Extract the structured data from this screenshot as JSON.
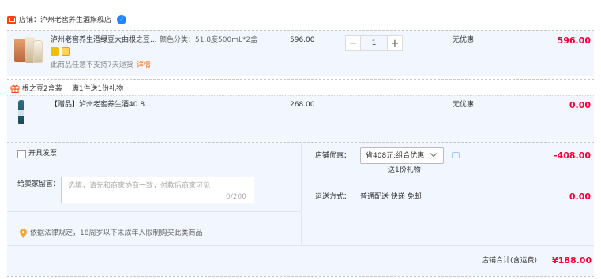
{
  "shop": {
    "label": "店铺：泸州老窖养生酒旗舰店",
    "badge_icon": "verified-icon",
    "badge_glyph": "✓"
  },
  "items": [
    {
      "title": "泸州老窖养生酒绿豆大曲根之豆...",
      "spec": "颜色分类：51.8度500mL*2盒",
      "note": "此商品任意不支持7天退货",
      "note_link": "详情",
      "unit_price": "596.00",
      "quantity": "1",
      "promo": "无优惠",
      "subtotal": "596.00"
    },
    {
      "title": "【赠品】泸州老窖养生酒40.8...",
      "unit_price": "268.00",
      "promo": "无优惠",
      "subtotal": "0.00"
    }
  ],
  "gift_bar": {
    "name": "根之豆2盒装",
    "desc": "满1件送1份礼物"
  },
  "order": {
    "invoice_label": "开具发票",
    "message_label": "给卖家留言：",
    "message_placeholder": "选填，请先和商家协商一致，付款后商家可见",
    "message_count": "0/200",
    "law_note": "依据法律规定，18周岁以下未成年人限制购买此类商品",
    "discount_label": "店铺优惠：",
    "discount_select": "省408元:组合优惠",
    "discount_sub": "送1份礼物",
    "discount_amount": "-408.00",
    "shipping_label": "运送方式：",
    "shipping_value": "普通配送 快递 免邮",
    "shipping_amount": "0.00",
    "total_label": "店铺合计(含运费)",
    "total_value": "¥188.00"
  },
  "colors": {
    "accent_red": "#ff0036",
    "shop_tag": "#ff4400",
    "panel_bg": "#f2f7ff"
  }
}
